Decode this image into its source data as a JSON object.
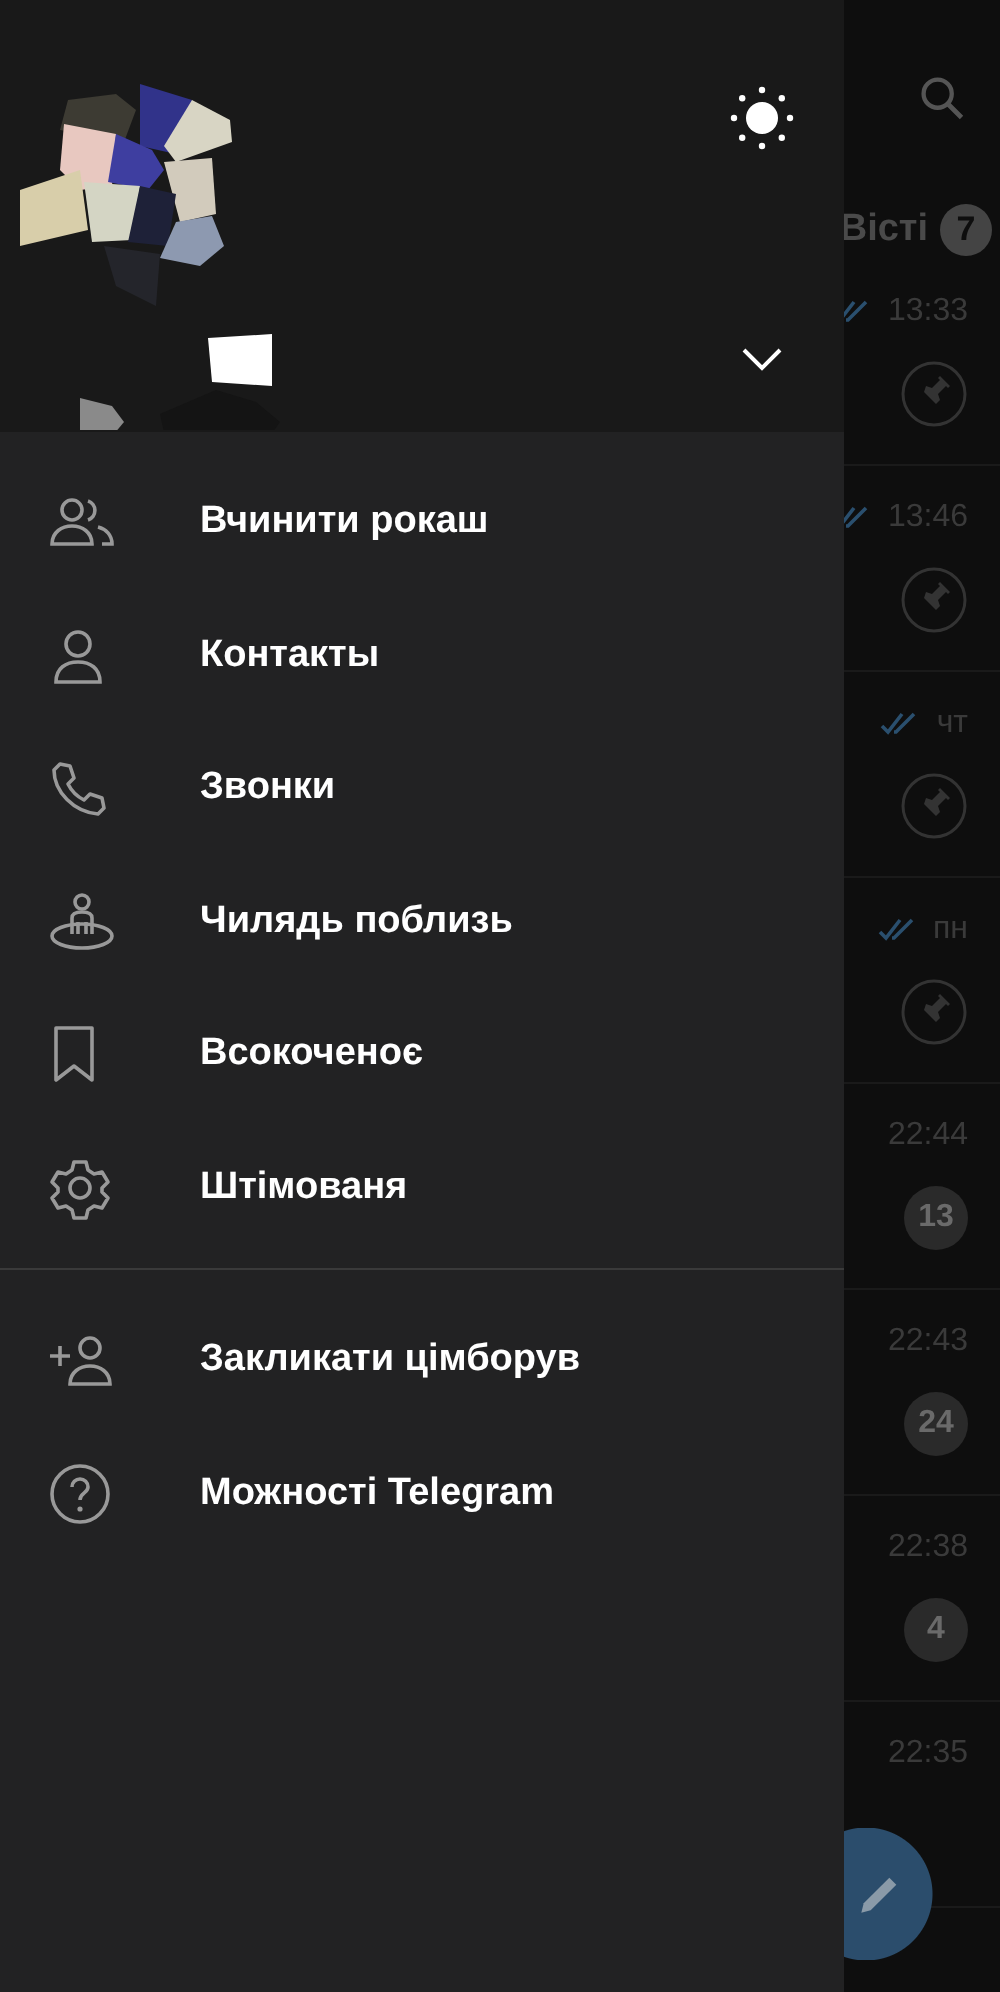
{
  "drawer": {
    "menu": [
      {
        "kind": "group",
        "label": "Вчинити рокаш"
      },
      {
        "kind": "person",
        "label": "Контакты"
      },
      {
        "kind": "phone",
        "label": "Звонки"
      },
      {
        "kind": "nearby",
        "label": "Чилядь поблизь"
      },
      {
        "kind": "bookmark",
        "label": "Всокоченоє"
      },
      {
        "kind": "gear",
        "label": "Штімованя"
      }
    ],
    "extra": [
      {
        "kind": "invite",
        "label": "Закликати цімборув"
      },
      {
        "kind": "help",
        "label": "Можності Telegram"
      }
    ]
  },
  "chat_list": {
    "tab": {
      "label": "Вісті",
      "count": "7"
    },
    "rows": [
      {
        "time": "13:33",
        "read": true,
        "pinned": true
      },
      {
        "time": "13:46",
        "read": true,
        "pinned": true
      },
      {
        "time": "чт",
        "read": true,
        "pinned": true
      },
      {
        "time": "пн",
        "read": true,
        "pinned": true
      },
      {
        "time": "22:44",
        "read": false,
        "pinned": false,
        "unread": "13"
      },
      {
        "time": "22:43",
        "read": false,
        "pinned": false,
        "unread": "24"
      },
      {
        "time": "22:38",
        "read": false,
        "pinned": false,
        "unread": "4"
      },
      {
        "time": "22:35",
        "read": false,
        "pinned": false
      }
    ]
  }
}
